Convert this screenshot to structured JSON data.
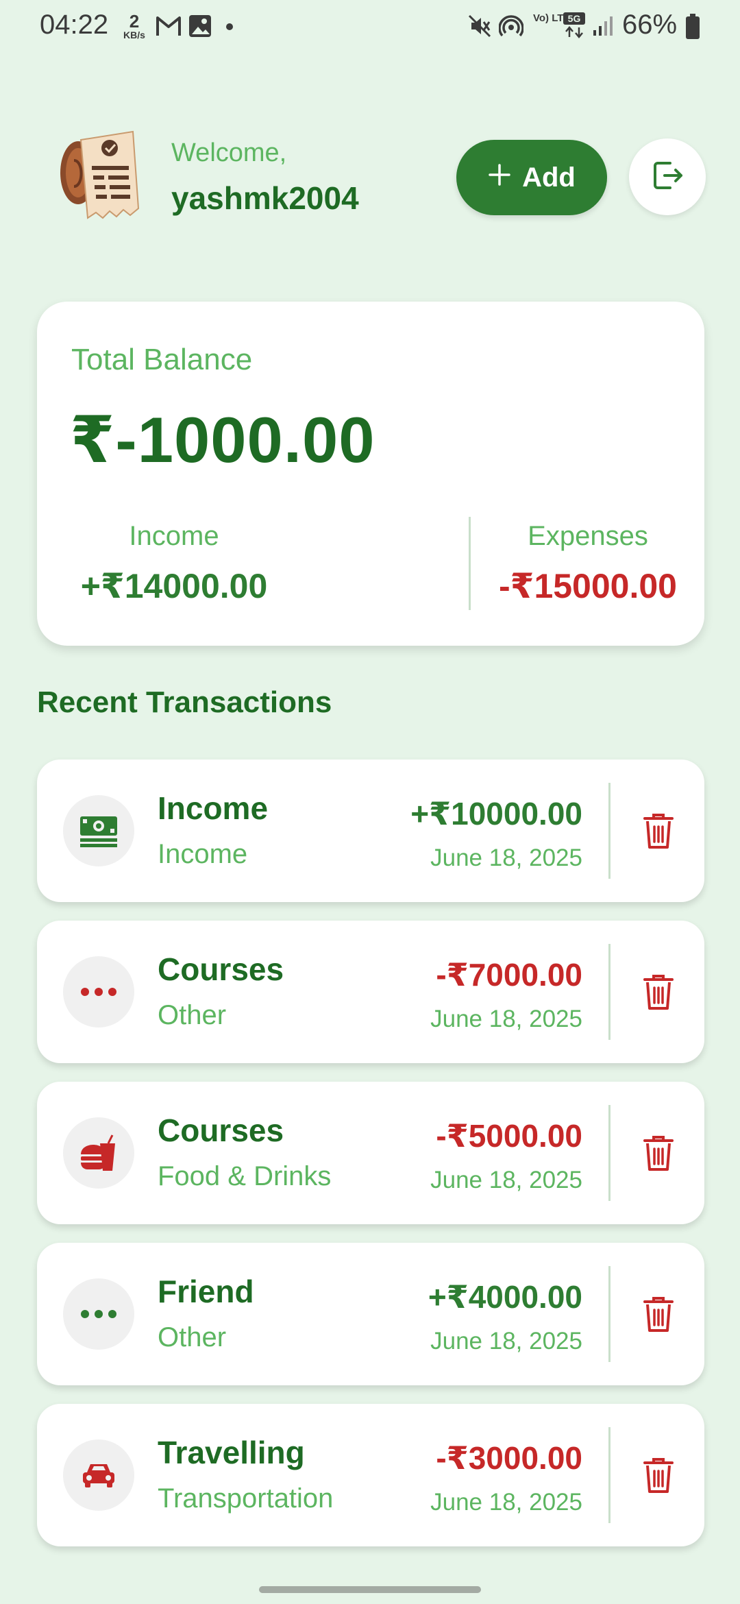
{
  "status_bar": {
    "time": "04:22",
    "net_speed_value": "2",
    "net_speed_unit": "KB/s",
    "volte": "Vo) LTE",
    "network": "5G",
    "battery": "66%"
  },
  "header": {
    "welcome": "Welcome,",
    "username": "yashmk2004",
    "add_label": "Add"
  },
  "balance": {
    "label": "Total Balance",
    "amount": "₹-1000.00",
    "income_label": "Income",
    "income_amount": "+₹14000.00",
    "expenses_label": "Expenses",
    "expenses_amount": "-₹15000.00"
  },
  "section_title": "Recent Transactions",
  "transactions": [
    {
      "title": "Income",
      "category": "Income",
      "amount": "+₹10000.00",
      "date": "June 18, 2025",
      "icon": "cash-icon",
      "type": "income"
    },
    {
      "title": "Courses",
      "category": "Other",
      "amount": "-₹7000.00",
      "date": "June 18, 2025",
      "icon": "more-icon",
      "type": "expense"
    },
    {
      "title": "Courses",
      "category": "Food & Drinks",
      "amount": "-₹5000.00",
      "date": "June 18, 2025",
      "icon": "food-drink-icon",
      "type": "expense"
    },
    {
      "title": "Friend",
      "category": "Other",
      "amount": "+₹4000.00",
      "date": "June 18, 2025",
      "icon": "more-icon",
      "type": "income"
    },
    {
      "title": "Travelling",
      "category": "Transportation",
      "amount": "-₹3000.00",
      "date": "June 18, 2025",
      "icon": "car-icon",
      "type": "expense"
    }
  ],
  "colors": {
    "background": "#e6f4e8",
    "primary": "#2e7d32",
    "dark_green": "#1e6b24",
    "light_green": "#5cb560",
    "expense_red": "#c62828"
  }
}
